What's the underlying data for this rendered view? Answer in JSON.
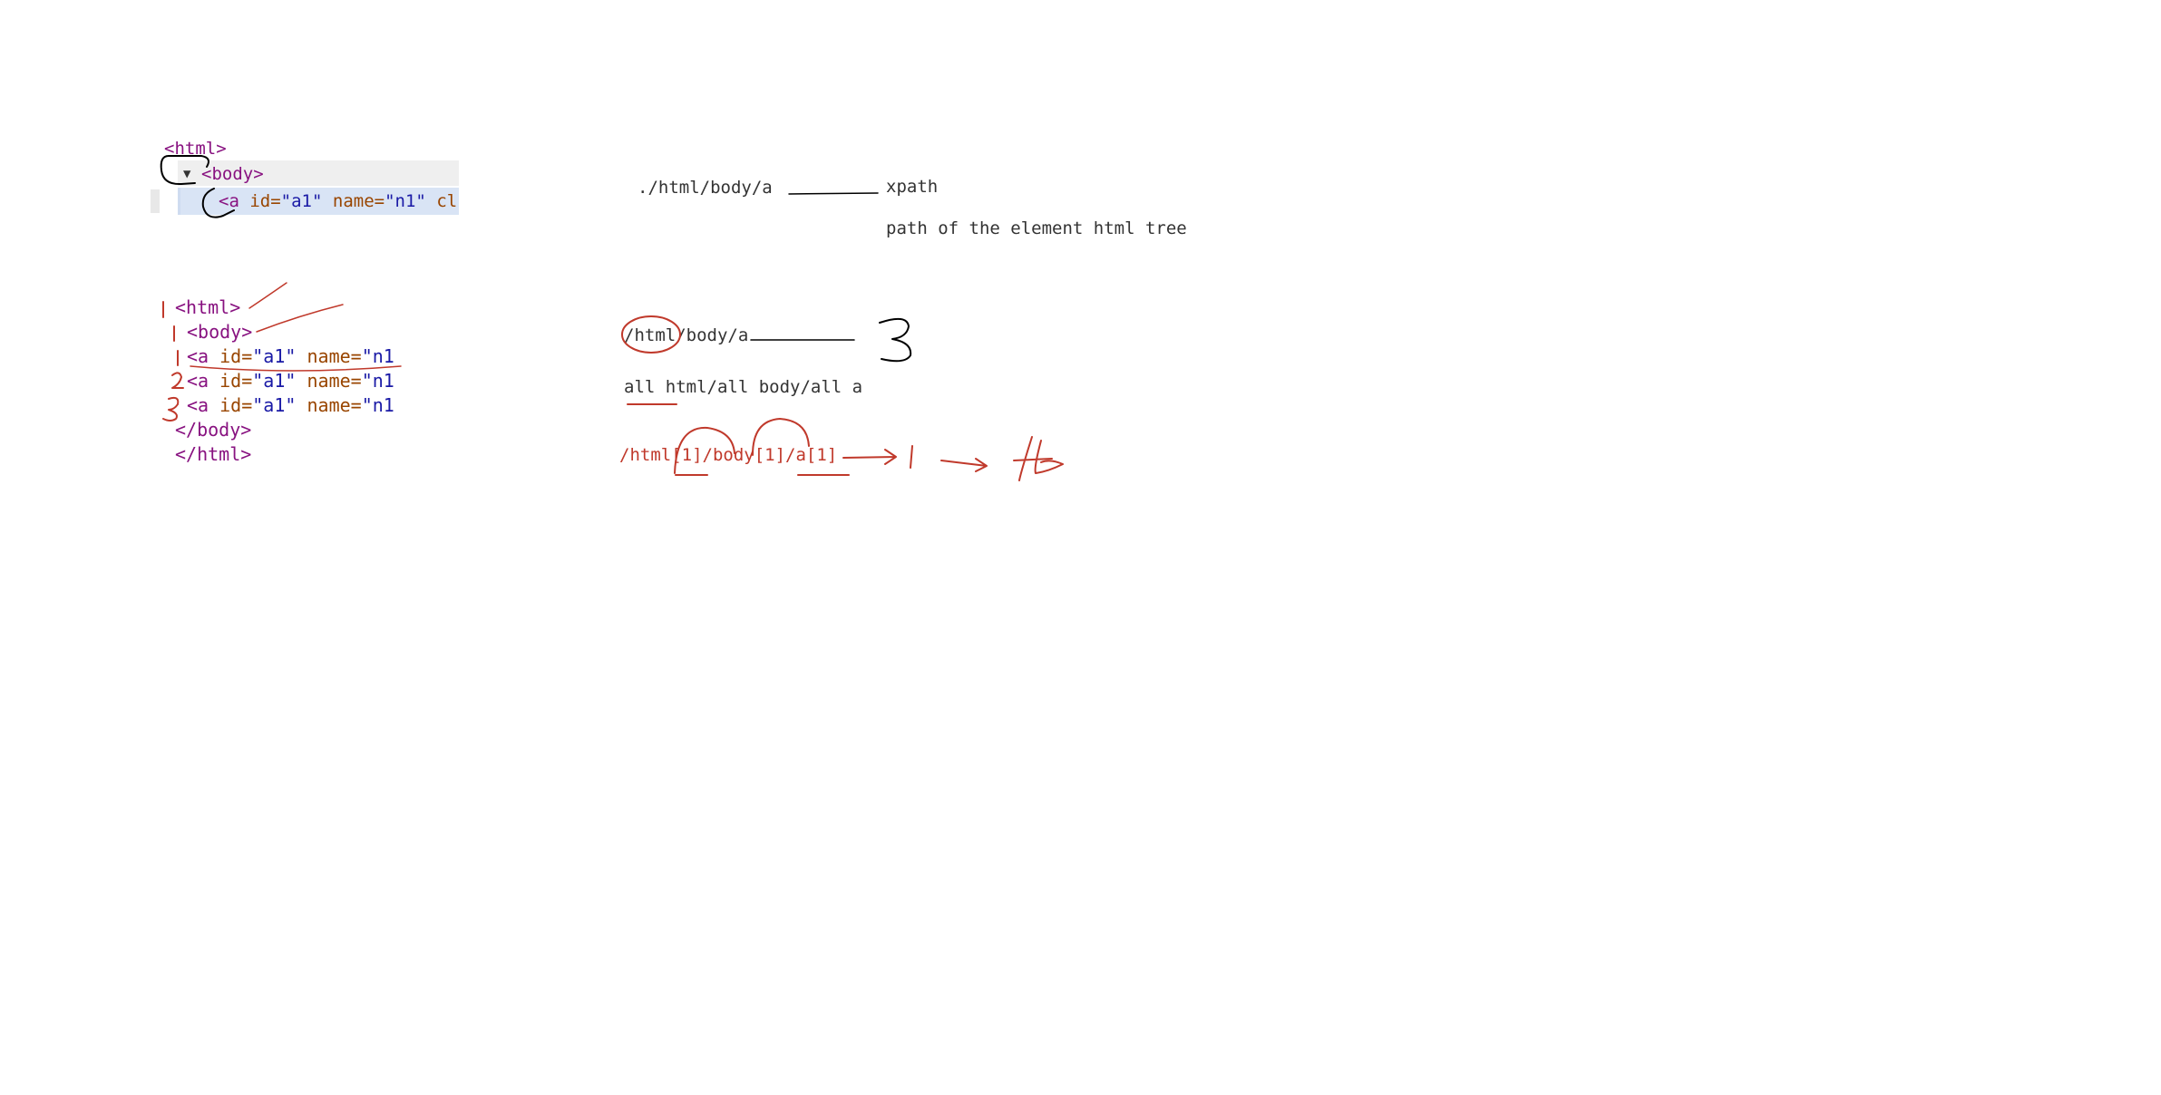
{
  "devtools": {
    "line_html": "<html>",
    "line_body": "<body>",
    "line_a": {
      "open": "<a ",
      "id_attr": "id",
      "id_val": "\"a1\"",
      "name_attr": "name",
      "name_val": "\"n1\"",
      "rest": "cl"
    }
  },
  "code_listing": {
    "html_open": "<html>",
    "body_open": "<body>",
    "anchor": {
      "open": "<a ",
      "id_attr": "id",
      "eq": "=",
      "id_val": "\"a1\"",
      "name_attr": "name",
      "name_val": "\"n1"
    },
    "body_close": "</body>",
    "html_close": "</html>"
  },
  "notes": {
    "relative_path": "./html/body/a",
    "xpath_label": "xpath",
    "xpath_definition": "path of the element html tree",
    "absolute_path": "/html/body/a",
    "all_matches": "all html/all body/all a",
    "indexed_path": "/html[1]/body[1]/a[1]"
  },
  "colors": {
    "tag": "#881280",
    "attribute": "#994500",
    "value": "#1a1aa6",
    "annotation_red": "#c0392b",
    "annotation_black": "#000000",
    "note_text": "#333333",
    "selected_row": "#d9e4f5"
  }
}
